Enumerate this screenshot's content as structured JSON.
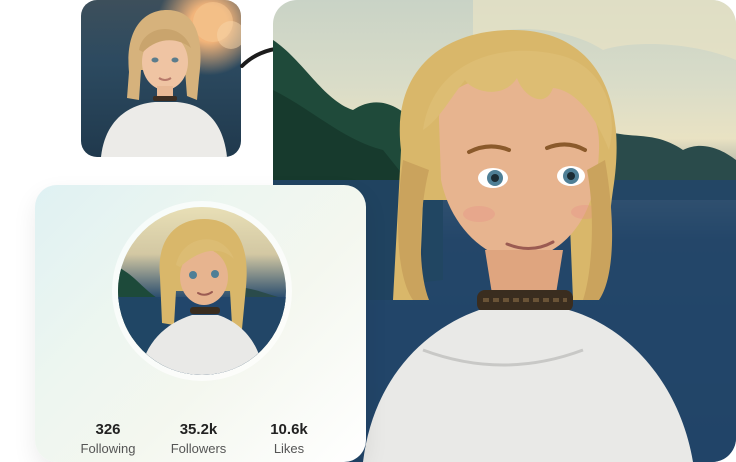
{
  "profile": {
    "stats": [
      {
        "value": "326",
        "label": "Following"
      },
      {
        "value": "35.2k",
        "label": "Followers"
      },
      {
        "value": "10.6k",
        "label": "Likes"
      }
    ]
  },
  "colors": {
    "text_primary": "#222222",
    "text_secondary": "#555555",
    "hair": "#d9b76a",
    "skin": "#e7b48f",
    "shirt": "#e9e9e7",
    "water": "#22456a"
  },
  "icons": {
    "transform_arrow": "curved-arrow-right-icon"
  }
}
